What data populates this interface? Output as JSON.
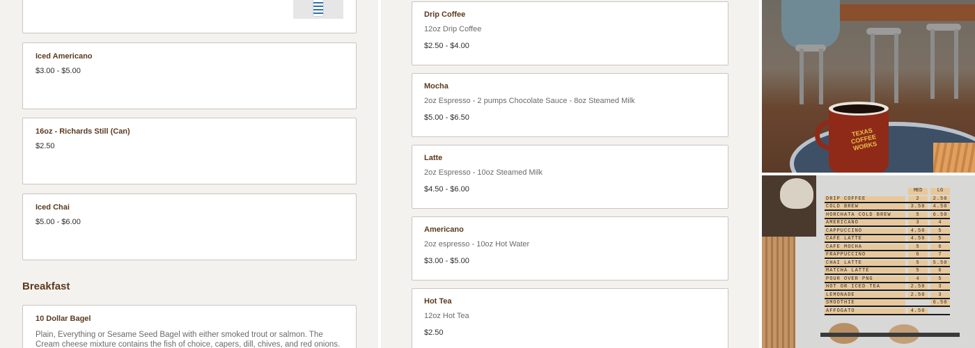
{
  "left_menu": {
    "items": [
      {
        "name": "Iced Americano",
        "price": "$3.00 - $5.00"
      },
      {
        "name": "16oz - Richards Still (Can)",
        "price": "$2.50"
      },
      {
        "name": "Iced Chai",
        "price": "$5.00 - $6.00"
      }
    ],
    "section_title": "Breakfast",
    "breakfast_item": {
      "name": "10 Dollar Bagel",
      "description": "Plain, Everything or Sesame Seed Bagel with either smoked trout or salmon. The Cream cheese mixture contains the fish of choice, capers, dill, chives, and red onions."
    }
  },
  "mid_menu": {
    "items": [
      {
        "name": "Drip Coffee",
        "description": "12oz Drip Coffee",
        "price": "$2.50 - $4.00"
      },
      {
        "name": "Mocha",
        "description": "2oz Espresso - 2 pumps Chocolate Sauce - 8oz Steamed Milk",
        "price": "$5.00 - $6.50"
      },
      {
        "name": "Latte",
        "description": "2oz Espresso - 10oz Steamed Milk",
        "price": "$4.50 - $6.00"
      },
      {
        "name": "Americano",
        "description": "2oz espresso - 10oz Hot Water",
        "price": "$3.00 - $5.00"
      },
      {
        "name": "Hot Tea",
        "description": "12oz Hot Tea",
        "price": "$2.50"
      }
    ]
  },
  "photo1": {
    "mug_logo": "TEXAS COFFEE WORKS"
  },
  "menu_board": {
    "headers": [
      "MED",
      "LG"
    ],
    "rows": [
      {
        "label": "DRIP COFFEE",
        "med": "2",
        "lg": "2.50"
      },
      {
        "label": "COLD BREW",
        "med": "3.50",
        "lg": "4.50"
      },
      {
        "label": "HORCHATA COLD BREW",
        "med": "5",
        "lg": "6.50"
      },
      {
        "label": "AMERICANO",
        "med": "3",
        "lg": "4"
      },
      {
        "label": "CAPPUCCINO",
        "med": "4.50",
        "lg": "5"
      },
      {
        "label": "CAFE LATTE",
        "med": "4.50",
        "lg": "5"
      },
      {
        "label": "CAFE MOCHA",
        "med": "5",
        "lg": "6"
      },
      {
        "label": "FRAPPUCCINO",
        "med": "6",
        "lg": "7"
      },
      {
        "label": "CHAI LATTE",
        "med": "5",
        "lg": "5.50"
      },
      {
        "label": "MATCHA LATTE",
        "med": "5",
        "lg": "6"
      },
      {
        "label": "POUR OVER PNG",
        "med": "4",
        "lg": "5"
      },
      {
        "label": "HOT OR ICED TEA",
        "med": "2.50",
        "lg": "3"
      },
      {
        "label": "LEMONADE",
        "med": "2.50",
        "lg": "3"
      },
      {
        "label": "SMOOTHIE",
        "med": "",
        "lg": "6.50"
      },
      {
        "label": "AFFOGATO",
        "med": "4.50",
        "lg": ""
      }
    ]
  }
}
